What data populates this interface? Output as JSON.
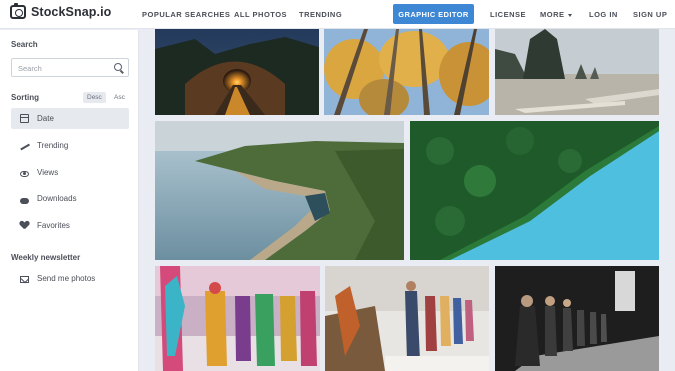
{
  "header": {
    "logo_text": "StockSnap.io",
    "nav": {
      "popular": "POPULAR SEARCHES",
      "all_photos": "ALL PHOTOS",
      "trending": "TRENDING",
      "graphic_editor": "GRAPHIC EDITOR",
      "license": "LICENSE",
      "more": "MORE",
      "login": "LOG IN",
      "signup": "SIGN UP"
    }
  },
  "sidebar": {
    "search_title": "Search",
    "search_placeholder": "Search",
    "sorting_title": "Sorting",
    "sort_desc": "Desc",
    "sort_asc": "Asc",
    "sort_items": [
      {
        "label": "Date",
        "icon": "calendar-icon",
        "active": true
      },
      {
        "label": "Trending",
        "icon": "trend-icon",
        "active": false
      },
      {
        "label": "Views",
        "icon": "eye-icon",
        "active": false
      },
      {
        "label": "Downloads",
        "icon": "cloud-download-icon",
        "active": false
      },
      {
        "label": "Favorites",
        "icon": "heart-icon",
        "active": false
      }
    ],
    "newsletter_title": "Weekly newsletter",
    "newsletter_link": "Send me photos"
  },
  "colors": {
    "accent": "#3d87d4",
    "background": "#e9ecf2"
  },
  "photos": [
    {
      "subject": "tunnel-road-night"
    },
    {
      "subject": "autumn-forest-trees"
    },
    {
      "subject": "rocky-beach-sea-stacks"
    },
    {
      "subject": "coastal-cliff-aerial"
    },
    {
      "subject": "forest-lake-aerial"
    },
    {
      "subject": "colorful-fashion-runway"
    },
    {
      "subject": "fashion-show-runway"
    },
    {
      "subject": "runway-models-black-white"
    }
  ]
}
